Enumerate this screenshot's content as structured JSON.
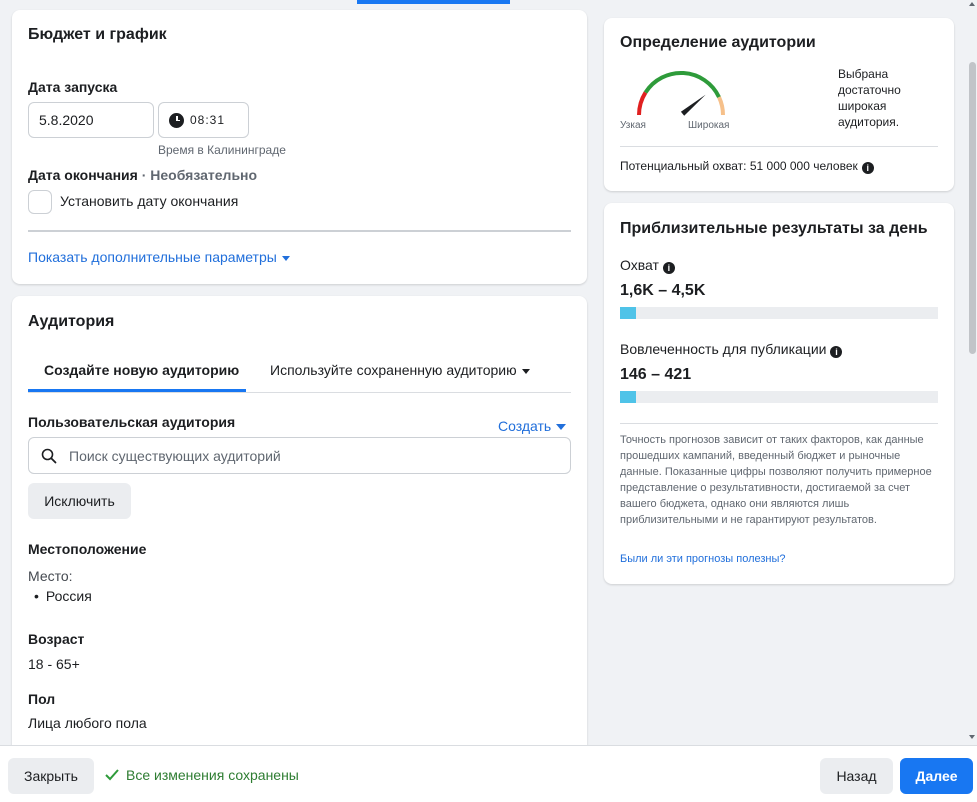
{
  "budget": {
    "title": "Бюджет и график",
    "start_label": "Дата запуска",
    "start_date": "5.8.2020",
    "start_time": "08:31",
    "timezone": "Время в Калининграде",
    "end_label": "Дата окончания",
    "end_optional": " · Необязательно",
    "set_end_label": "Установить дату окончания",
    "more_params": "Показать дополнительные параметры"
  },
  "audience": {
    "title": "Аудитория",
    "tabs": [
      {
        "label": "Создайте новую аудиторию",
        "active": true
      },
      {
        "label": "Используйте сохраненную аудиторию",
        "active": false
      }
    ],
    "custom_label": "Пользовательская аудитория",
    "create_label": "Создать",
    "search_placeholder": "Поиск существующих аудиторий",
    "exclude_label": "Исключить",
    "location_label": "Местоположение",
    "place_label": "Место:",
    "place_value": "Россия",
    "age_label": "Возраст",
    "age_value": "18 - 65+",
    "gender_label": "Пол",
    "gender_value": "Лица любого пола"
  },
  "definition": {
    "title": "Определение аудитории",
    "narrow": "Узкая",
    "wide": "Широкая",
    "description": "Выбрана достаточно широкая аудитория.",
    "potential_reach": "Потенциальный охват: 51 000 000 человек",
    "gauge_level": 0.78,
    "colors": {
      "red": "#e02020",
      "green": "#2e9b3a",
      "peach": "#f6c08a",
      "needle": "#1c1e21"
    }
  },
  "results": {
    "title": "Приблизительные результаты за день",
    "reach_label": "Охват",
    "reach_value": "1,6K – 4,5K",
    "reach_fill": 0.05,
    "engagement_label": "Вовлеченность для публикации",
    "engagement_value": "146 – 421",
    "engagement_fill": 0.05,
    "disclaimer": "Точность прогнозов зависит от таких факторов, как данные прошедших кампаний, введенный бюджет и рыночные данные. Показанные цифры позволяют получить примерное представление о результативности, достигаемой за счет вашего бюджета, однако они являются лишь приблизительными и не гарантируют результатов.",
    "feedback_link": "Были ли эти прогнозы полезны?"
  },
  "footer": {
    "close_label": "Закрыть",
    "saved_status": "Все изменения сохранены",
    "back_label": "Назад",
    "next_label": "Далее"
  },
  "icons": {
    "clock": "clock-icon",
    "search": "search-icon",
    "info": "info-icon",
    "check": "check-icon"
  }
}
